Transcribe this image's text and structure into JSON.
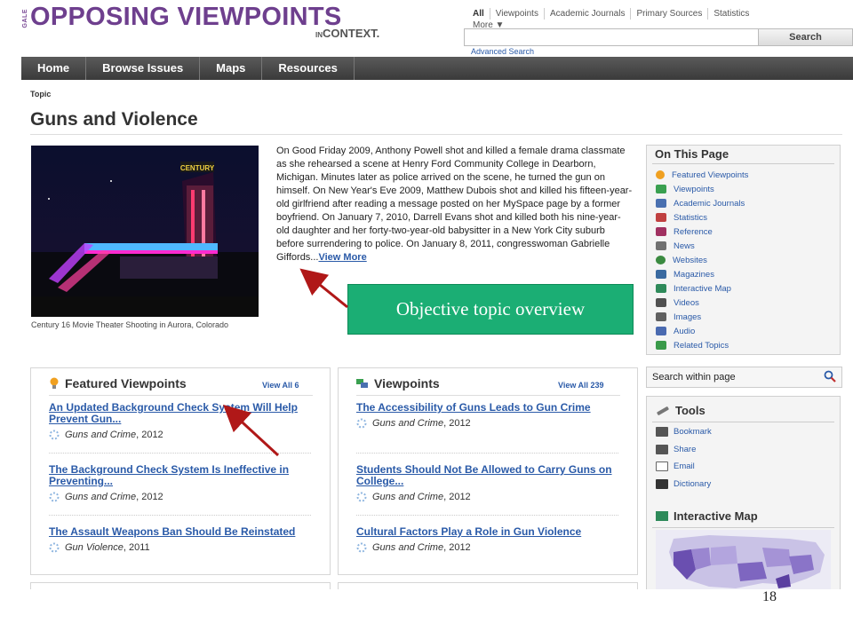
{
  "header": {
    "gale": "GALE",
    "logo_main": "OPPOSING VIEWPOINTS",
    "logo_in": "IN",
    "logo_context": "CONTEXT.",
    "search_tabs": [
      "All",
      "Viewpoints",
      "Academic Journals",
      "Primary Sources",
      "Statistics"
    ],
    "search_more": "More ▼",
    "search_value": "",
    "search_button": "Search",
    "advanced_search": "Advanced Search"
  },
  "nav": [
    "Home",
    "Browse Issues",
    "Maps",
    "Resources"
  ],
  "breadcrumb": "Topic",
  "page_title": "Guns and Violence",
  "hero": {
    "caption": "Century 16 Movie Theater Shooting in Aurora, Colorado",
    "sign_text": "CENTURY"
  },
  "overview": {
    "text": "On Good Friday 2009, Anthony Powell shot and killed a female drama classmate as she rehearsed a scene at Henry Ford Community College in Dearborn, Michigan. Minutes later as police arrived on the scene, he turned the gun on himself. On New Year's Eve 2009, Matthew Dubois shot and killed his fifteen-year-old girlfriend after reading a message posted on her MySpace page by a former boyfriend. On January 7, 2010, Darrell Evans shot and killed both his nine-year-old daughter and her forty-two-year-old babysitter in a New York City suburb before surrendering to police. On January 8, 2011, congresswoman Gabrielle Giffords...",
    "view_more": "View More"
  },
  "callout": "Objective topic overview",
  "on_this_page": {
    "title": "On This Page",
    "items": [
      {
        "label": "Featured Viewpoints",
        "icon": "lightbulb-icon",
        "color": "#f0a020"
      },
      {
        "label": "Viewpoints",
        "icon": "viewpoints-icon",
        "color": "#3aa050"
      },
      {
        "label": "Academic Journals",
        "icon": "journals-icon",
        "color": "#4a70b0"
      },
      {
        "label": "Statistics",
        "icon": "statistics-icon",
        "color": "#c04040"
      },
      {
        "label": "Reference",
        "icon": "reference-icon",
        "color": "#a03060"
      },
      {
        "label": "News",
        "icon": "news-icon",
        "color": "#707070"
      },
      {
        "label": "Websites",
        "icon": "globe-icon",
        "color": "#3a8a40"
      },
      {
        "label": "Magazines",
        "icon": "magazine-icon",
        "color": "#3a6aa0"
      },
      {
        "label": "Interactive Map",
        "icon": "map-icon",
        "color": "#2e8a5a"
      },
      {
        "label": "Videos",
        "icon": "video-icon",
        "color": "#505050"
      },
      {
        "label": "Images",
        "icon": "camera-icon",
        "color": "#606060"
      },
      {
        "label": "Audio",
        "icon": "speaker-icon",
        "color": "#4a6ab0"
      },
      {
        "label": "Related Topics",
        "icon": "related-topics-icon",
        "color": "#3a9a4a"
      }
    ]
  },
  "search_within": {
    "label": "Search within page"
  },
  "tools": {
    "title": "Tools",
    "items": [
      "Bookmark",
      "Share",
      "Email",
      "Dictionary"
    ],
    "map_title": "Interactive Map"
  },
  "featured": {
    "title": "Featured Viewpoints",
    "view_all": "View All 6",
    "items": [
      {
        "title": "An Updated Background Check System Will Help Prevent Gun...",
        "source": "Guns and Crime",
        "year": ", 2012"
      },
      {
        "title": "The Background Check System Is Ineffective in Preventing...",
        "source": "Guns and Crime",
        "year": ", 2012"
      },
      {
        "title": "The Assault Weapons Ban Should Be Reinstated",
        "source": "Gun Violence",
        "year": ", 2011"
      }
    ]
  },
  "viewpoints": {
    "title": "Viewpoints",
    "view_all": "View All 239",
    "items": [
      {
        "title": "The Accessibility of Guns Leads to Gun Crime",
        "source": "Guns and Crime",
        "year": ", 2012"
      },
      {
        "title": "Students Should Not Be Allowed to Carry Guns on College...",
        "source": "Guns and Crime",
        "year": ", 2012"
      },
      {
        "title": "Cultural Factors Play a Role in Gun Violence",
        "source": "Guns and Crime",
        "year": ", 2012"
      }
    ]
  },
  "slide_number": "18",
  "colors": {
    "brand": "#6e3f8e",
    "link": "#2a5aa8",
    "callout": "#1bae74",
    "arrow": "#b01818"
  }
}
